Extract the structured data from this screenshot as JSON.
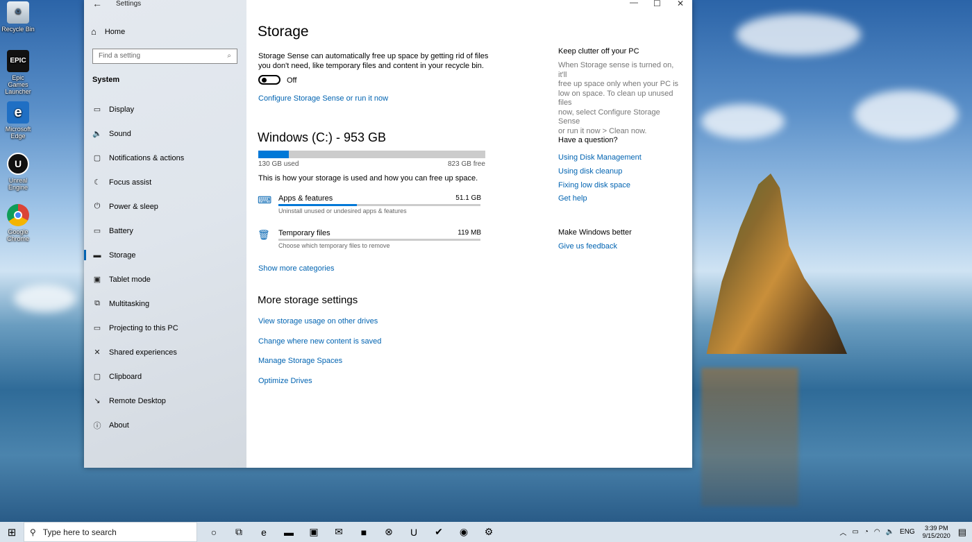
{
  "desktop": {
    "icons": [
      {
        "label": "Recycle Bin",
        "icon": "recycle-bin-icon"
      },
      {
        "label": "Epic Games Launcher",
        "icon": "epic-games-icon",
        "img_text": "EPIC"
      },
      {
        "label": "Microsoft Edge",
        "icon": "edge-icon",
        "img_text": "e"
      },
      {
        "label": "Unreal Engine",
        "icon": "unreal-engine-icon",
        "img_text": "U"
      },
      {
        "label": "Google Chrome",
        "icon": "chrome-icon"
      }
    ]
  },
  "window": {
    "title": "Settings",
    "back_glyph": "←",
    "minimize_glyph": "—",
    "maximize_glyph": "☐",
    "close_glyph": "✕"
  },
  "sidebar": {
    "home_label": "Home",
    "search_placeholder": "Find a setting",
    "section_label": "System",
    "items": [
      {
        "label": "Display",
        "icon": "display-icon",
        "glyph": "▭"
      },
      {
        "label": "Sound",
        "icon": "sound-icon",
        "glyph": "🔈"
      },
      {
        "label": "Notifications & actions",
        "icon": "notifications-icon",
        "glyph": "▢"
      },
      {
        "label": "Focus assist",
        "icon": "moon-icon",
        "glyph": "☾"
      },
      {
        "label": "Power & sleep",
        "icon": "power-icon",
        "glyph": "⏻"
      },
      {
        "label": "Battery",
        "icon": "battery-icon",
        "glyph": "▭"
      },
      {
        "label": "Storage",
        "icon": "storage-icon",
        "glyph": "▬",
        "active": true
      },
      {
        "label": "Tablet mode",
        "icon": "tablet-icon",
        "glyph": "▣"
      },
      {
        "label": "Multitasking",
        "icon": "multitasking-icon",
        "glyph": "⧉"
      },
      {
        "label": "Projecting to this PC",
        "icon": "projecting-icon",
        "glyph": "▭"
      },
      {
        "label": "Shared experiences",
        "icon": "shared-icon",
        "glyph": "✕"
      },
      {
        "label": "Clipboard",
        "icon": "clipboard-icon",
        "glyph": "▢"
      },
      {
        "label": "Remote Desktop",
        "icon": "remote-desktop-icon",
        "glyph": "↘"
      },
      {
        "label": "About",
        "icon": "info-icon",
        "glyph": "ⓘ"
      }
    ]
  },
  "main": {
    "title": "Storage",
    "sense_desc_line1": "Storage Sense can automatically free up space by getting rid of files",
    "sense_desc_line2": "you don't need, like temporary files and content in your recycle bin.",
    "toggle_state": "Off",
    "configure_link": "Configure Storage Sense or run it now",
    "drive_title": "Windows (C:) - 953 GB",
    "drive_used_fraction": 0.136,
    "used_label": "130 GB used",
    "free_label": "823 GB free",
    "usage_desc": "This is how your storage is used and how you can free up space.",
    "categories": [
      {
        "name": "Apps & features",
        "size": "51.1 GB",
        "desc": "Uninstall unused or undesired apps & features",
        "fraction": 0.39,
        "icon": "keyboard-icon",
        "glyph": "⌨"
      },
      {
        "name": "Temporary files",
        "size": "119 MB",
        "desc": "Choose which temporary files to remove",
        "fraction": 0.0,
        "icon": "trash-icon",
        "glyph": "🗑"
      }
    ],
    "show_more_link": "Show more categories",
    "more_title": "More storage settings",
    "more_links": [
      "View storage usage on other drives",
      "Change where new content is saved",
      "Manage Storage Spaces",
      "Optimize Drives"
    ]
  },
  "right_panel": {
    "clutter_title": "Keep clutter off your PC",
    "clutter_lines": [
      "When Storage sense is turned on, it'll",
      "free up space only when your PC is",
      "low on space. To clean up unused files",
      "now, select Configure Storage Sense",
      "or run it now > Clean now."
    ],
    "question_title": "Have a question?",
    "question_links": [
      "Using Disk Management",
      "Using disk cleanup",
      "Fixing low disk space",
      "Get help"
    ],
    "better_title": "Make Windows better",
    "feedback_link": "Give us feedback"
  },
  "taskbar": {
    "search_placeholder": "Type here to search",
    "apps": [
      {
        "icon": "cortana-icon",
        "glyph": "○"
      },
      {
        "icon": "task-view-icon",
        "glyph": "⧉"
      },
      {
        "icon": "edge-taskbar-icon",
        "glyph": "e"
      },
      {
        "icon": "file-explorer-icon",
        "glyph": "▬"
      },
      {
        "icon": "store-icon",
        "glyph": "▣"
      },
      {
        "icon": "mail-icon",
        "glyph": "✉"
      },
      {
        "icon": "app-red-icon",
        "glyph": "■"
      },
      {
        "icon": "xbox-icon",
        "glyph": "⊗"
      },
      {
        "icon": "unreal-taskbar-icon",
        "glyph": "U"
      },
      {
        "icon": "norton-icon",
        "glyph": "✔"
      },
      {
        "icon": "chrome-taskbar-icon",
        "glyph": "◉"
      },
      {
        "icon": "settings-taskbar-icon",
        "glyph": "⚙"
      }
    ],
    "language": "ENG",
    "time": "3:39 PM",
    "date": "9/15/2020"
  },
  "colors": {
    "accent": "#0078d7",
    "link": "#0063b1"
  }
}
